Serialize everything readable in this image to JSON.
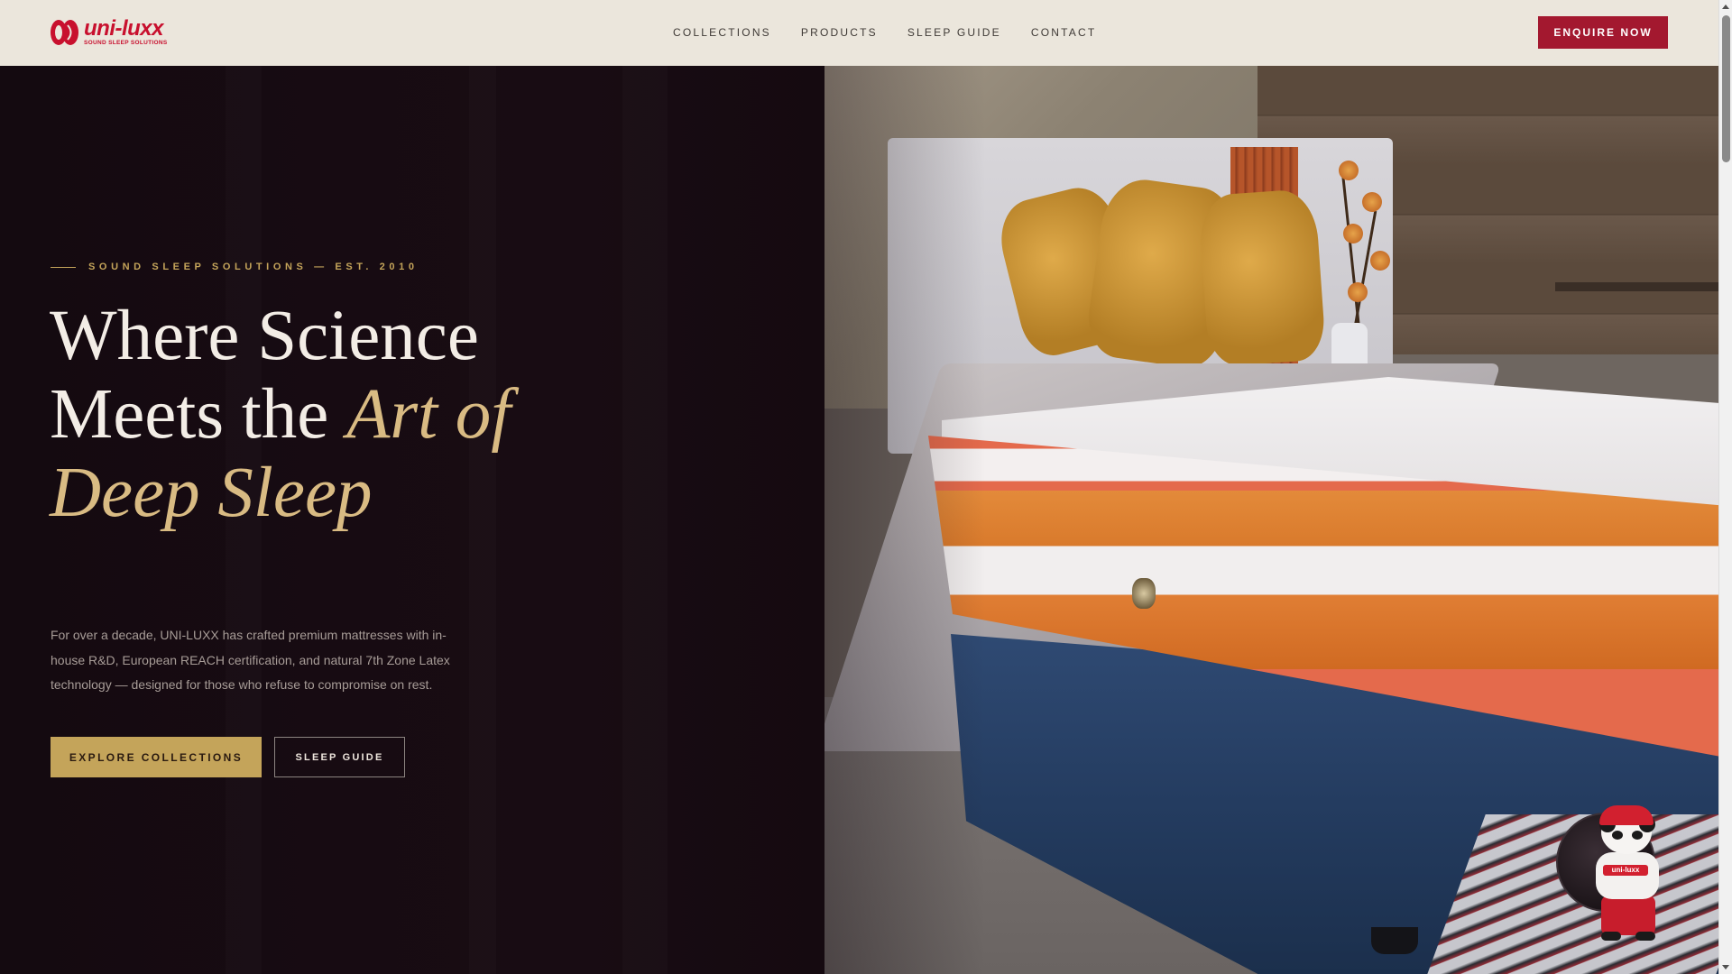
{
  "brand": {
    "logo_word": "uni-luxx",
    "logo_tagline": "SOUND SLEEP SOLUTIONS",
    "color": "#c8102e"
  },
  "nav": {
    "items": [
      {
        "label": "COLLECTIONS"
      },
      {
        "label": "PRODUCTS"
      },
      {
        "label": "SLEEP GUIDE"
      },
      {
        "label": "CONTACT"
      }
    ],
    "cta_label": "ENQUIRE NOW"
  },
  "hero": {
    "eyebrow": "SOUND SLEEP SOLUTIONS — EST. 2010",
    "headline_line1": "Where Science",
    "headline_line2_plain": "Meets the ",
    "headline_line2_accent": "Art of",
    "headline_line3_accent": "Deep Sleep",
    "description": "For over a decade, UNI-LUXX has crafted premium mattresses with in-house R&D, European REACH certification, and natural 7th Zone Latex technology — designed for those who refuse to compromise on rest.",
    "primary_button": "EXPLORE COLLECTIONS",
    "secondary_button": "SLEEP GUIDE"
  },
  "mascot": {
    "shirt_text": "uni-luxx"
  },
  "colors": {
    "header_bg": "#ebe6dc",
    "hero_bg": "#140a10",
    "gold": "#c4a45a",
    "accent_text": "#d9bb83",
    "cta_red": "#a3182f"
  },
  "icons": [
    "logo-mark-icon",
    "chat-mascot-icon"
  ]
}
